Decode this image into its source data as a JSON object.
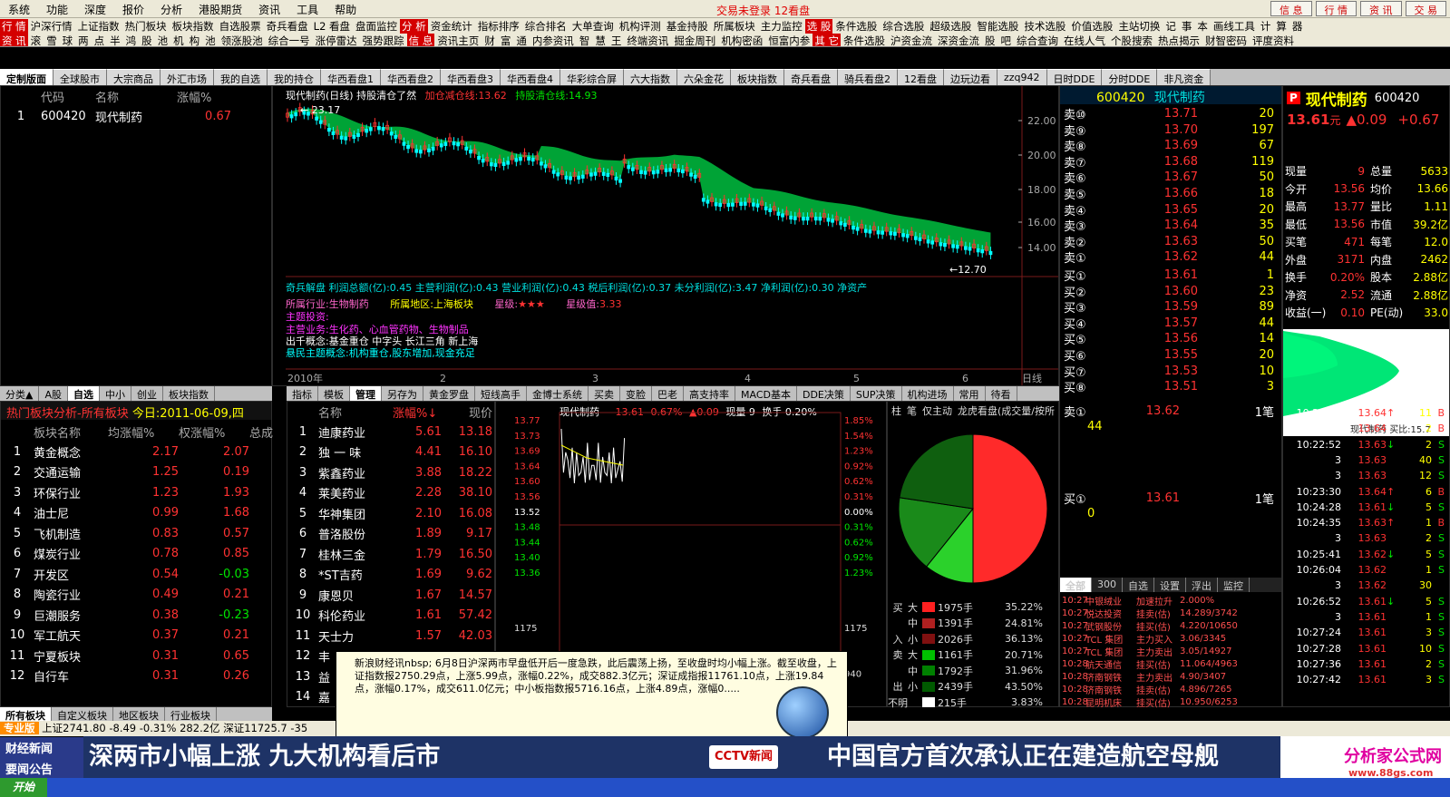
{
  "menu": {
    "items": [
      "系统",
      "功能",
      "深度",
      "报价",
      "分析",
      "港股期货",
      "资讯",
      "工具",
      "帮助"
    ],
    "center": "交易未登录 12看盘",
    "right_buttons": [
      "信 息",
      "行 情",
      "资 讯",
      "交 易"
    ]
  },
  "toolbar": {
    "row1": [
      "沪深行情",
      "上证指数",
      "热门板块",
      "板块指数",
      "自选股票",
      "奇兵看盘",
      "L2 看盘",
      "盘面监控",
      "资金统计",
      "指标排序",
      "综合排名",
      "大单查询",
      "机构评测",
      "基金持股",
      "所属板块",
      "主力监控",
      "条件选股",
      "综合选股",
      "超级选股",
      "智能选股",
      "技术选股",
      "价值选股",
      "主站切换",
      "记",
      "事",
      "本",
      "画线工具",
      "计",
      "算",
      "器"
    ],
    "row2": [
      "滚",
      "雪",
      "球",
      "两",
      "点",
      "半",
      "鸿",
      "股",
      "池",
      "机",
      "构",
      "池",
      "领涨股池",
      "综合一号",
      "涨停雷达",
      "强势跟踪",
      "资讯主页",
      "财",
      "富",
      "通",
      "内参资讯",
      "智",
      "慧",
      "王",
      "终端资讯",
      "掘金周刊",
      "机构密函",
      "恒富内参",
      "条件选股",
      "沪资金流",
      "深资金流",
      "股",
      "吧",
      "综合查询",
      "在线人气",
      "个股搜索",
      "热点揭示",
      "财智密码",
      "评度资料"
    ],
    "tags": [
      "行 情",
      "分 析",
      "资 讯",
      "选 股",
      "信 息",
      "其 它"
    ]
  },
  "tabs": [
    "定制版面",
    "全球股市",
    "大宗商品",
    "外汇市场",
    "我的自选",
    "我的持仓",
    "华西看盘1",
    "华西看盘2",
    "华西看盘3",
    "华西看盘4",
    "华彩综合屏",
    "六大指数",
    "六朵金花",
    "板块指数",
    "奇兵看盘",
    "骑兵看盘2",
    "12看盘",
    "边玩边看",
    "zzq942",
    "日时DDE",
    "分时DDE",
    "非凡资金"
  ],
  "watchlist": {
    "headers": [
      "代码",
      "名称",
      "涨幅%"
    ],
    "rows": [
      {
        "no": "1",
        "code": "600420",
        "name": "现代制药",
        "pct": "0.67"
      }
    ]
  },
  "left_subtabs": [
    "分类▲",
    "A股",
    "自选",
    "中小",
    "创业",
    "板块指数"
  ],
  "sectors": {
    "title": "热门板块分析-所有板块",
    "date": "今日:2011-06-09,四",
    "headers": [
      "板块名称",
      "均涨幅%",
      "权涨幅%",
      "总成"
    ],
    "rows": [
      [
        "1",
        "黄金概念",
        "2.17",
        "2.07"
      ],
      [
        "2",
        "交通运输",
        "1.25",
        "0.19"
      ],
      [
        "3",
        "环保行业",
        "1.23",
        "1.93"
      ],
      [
        "4",
        "油士尼",
        "0.99",
        "1.68"
      ],
      [
        "5",
        "飞机制造",
        "0.83",
        "0.57"
      ],
      [
        "6",
        "煤炭行业",
        "0.78",
        "0.85"
      ],
      [
        "7",
        "开发区",
        "0.54",
        "-0.03"
      ],
      [
        "8",
        "陶瓷行业",
        "0.49",
        "0.21"
      ],
      [
        "9",
        "巨潮服务",
        "0.38",
        "-0.23"
      ],
      [
        "10",
        "军工航天",
        "0.37",
        "0.21"
      ],
      [
        "11",
        "宁夏板块",
        "0.31",
        "0.65"
      ],
      [
        "12",
        "自行车",
        "0.31",
        "0.26"
      ]
    ],
    "bottom_tabs": [
      "所有板块",
      "自定义板块",
      "地区板块",
      "行业板块"
    ]
  },
  "kline": {
    "title": "现代制药(日线) 持股清仓了然",
    "line1_label": "加仓减仓线:",
    "line1_val": "13.62",
    "line2_label": "持股清仓线:",
    "line2_val": "14.93",
    "high_label": "23.17",
    "low_label": "12.70",
    "yticks": [
      "22.00",
      "20.00",
      "18.00",
      "16.00",
      "14.00"
    ],
    "xticks": [
      "2010年",
      "2",
      "3",
      "4",
      "5",
      "6",
      "日线"
    ],
    "fund_line": "奇兵解盘 利润总额(亿):0.45 主营利润(亿):0.43 营业利润(亿):0.43 税后利润(亿):0.37 未分利润(亿):3.47 净利润(亿):0.30 净资产",
    "industry": "所属行业:生物制药",
    "region": "所属地区:上海板块",
    "stars_label": "星级:",
    "stars": "★★★",
    "star_val_label": "星级值:",
    "star_val": "3.33",
    "topic_title": "主题投资:",
    "topic_lines": [
      "主营业务:生化药、心血管药物、生物制品",
      "出千概念:基金重仓 中字头 长江三角 新上海",
      "悬民主题概念:机构重仓,股东增加,现金充足"
    ]
  },
  "indicator_tabs": [
    "指标",
    "模板",
    "管理",
    "另存为",
    "黄金罗盘",
    "短线高手",
    "金博士系统",
    "买卖",
    "变脸",
    "巴老",
    "高支持率",
    "MACD基本",
    "DDE决策",
    "SUP决策",
    "机构进场",
    "常用",
    "待看"
  ],
  "gainers": {
    "headers": [
      "名称",
      "涨幅%↓",
      "现价"
    ],
    "rows": [
      [
        "1",
        "迪康药业",
        "5.61",
        "13.18"
      ],
      [
        "2",
        "独 一 味",
        "4.41",
        "16.10"
      ],
      [
        "3",
        "紫鑫药业",
        "3.88",
        "18.22"
      ],
      [
        "4",
        "莱美药业",
        "2.28",
        "38.10"
      ],
      [
        "5",
        "华神集团",
        "2.10",
        "16.08"
      ],
      [
        "6",
        "普洛股份",
        "1.89",
        "9.17"
      ],
      [
        "7",
        "桂林三金",
        "1.79",
        "16.50"
      ],
      [
        "8",
        "*ST吉药",
        "1.69",
        "9.62"
      ],
      [
        "9",
        "康恩贝",
        "1.67",
        "14.57"
      ],
      [
        "10",
        "科伦药业",
        "1.61",
        "57.42"
      ],
      [
        "11",
        "天士力",
        "1.57",
        "42.03"
      ],
      [
        "12",
        "丰",
        "",
        " "
      ],
      [
        "13",
        "益",
        "",
        " "
      ],
      [
        "14",
        "嘉",
        "",
        " "
      ]
    ]
  },
  "intraday": {
    "title": "现代制药",
    "price": "13.61",
    "pct": "0.67%",
    "chg": "▲0.09",
    "vol": "现量 9",
    "turnover": "换手 0.20%",
    "left_ticks": [
      "13.77",
      "13.73",
      "13.69",
      "13.64",
      "13.60",
      "13.56",
      "13.52",
      "13.48",
      "13.44",
      "13.40",
      "13.36",
      "1175",
      "940"
    ],
    "right_ticks": [
      "1.85%",
      "1.54%",
      "1.23%",
      "0.92%",
      "0.62%",
      "0.31%",
      "0.00%",
      "0.31%",
      "0.62%",
      "0.92%",
      "1.23%",
      "1175",
      "940"
    ]
  },
  "pie": {
    "tabs": [
      "柱",
      "笔",
      "仅主动",
      "龙虎看盘(成交量/按所"
    ],
    "rows": [
      {
        "side": "买",
        "size": "大",
        "vol": "1975手",
        "pct": "35.22%",
        "color": "#ff2020"
      },
      {
        "side": "",
        "size": "中",
        "vol": "1391手",
        "pct": "24.81%",
        "color": "#b02020"
      },
      {
        "side": "入",
        "size": "小",
        "vol": "2026手",
        "pct": "36.13%",
        "color": "#801010"
      },
      {
        "side": "卖",
        "size": "大",
        "vol": "1161手",
        "pct": "20.71%",
        "color": "#00c000"
      },
      {
        "side": "",
        "size": "中",
        "vol": "1792手",
        "pct": "31.96%",
        "color": "#008000"
      },
      {
        "side": "出",
        "size": "小",
        "vol": "2439手",
        "pct": "43.50%",
        "color": "#005a00"
      },
      {
        "side": "不明",
        "size": "",
        "vol": "215手",
        "pct": "3.83%",
        "color": "#ffffff"
      }
    ],
    "slices": [
      35.22,
      24.81,
      36.13,
      20.71,
      31.96,
      43.5,
      3.83
    ]
  },
  "orderbook": {
    "code": "600420",
    "name": "现代制药",
    "asks": [
      [
        "卖⑩",
        "13.71",
        "20"
      ],
      [
        "卖⑨",
        "13.70",
        "197"
      ],
      [
        "卖⑧",
        "13.69",
        "67"
      ],
      [
        "卖⑦",
        "13.68",
        "119"
      ],
      [
        "卖⑥",
        "13.67",
        "50"
      ],
      [
        "卖⑤",
        "13.66",
        "18"
      ],
      [
        "卖④",
        "13.65",
        "20"
      ],
      [
        "卖③",
        "13.64",
        "35"
      ],
      [
        "卖②",
        "13.63",
        "50"
      ],
      [
        "卖①",
        "13.62",
        "44"
      ]
    ],
    "bids": [
      [
        "买①",
        "13.61",
        "1"
      ],
      [
        "买②",
        "13.60",
        "23"
      ],
      [
        "买③",
        "13.59",
        "89"
      ],
      [
        "买④",
        "13.57",
        "44"
      ],
      [
        "买⑤",
        "13.56",
        "14"
      ],
      [
        "买⑥",
        "13.55",
        "20"
      ],
      [
        "买⑦",
        "13.53",
        "10"
      ],
      [
        "买⑧",
        "13.51",
        "3"
      ]
    ],
    "queue_sell": {
      "label": "卖①",
      "price": "13.62",
      "count": "1笔",
      "vol": "44"
    },
    "queue_buy": {
      "label": "买①",
      "price": "13.61",
      "count": "1笔",
      "vol": "0"
    },
    "subtabs": [
      "全部",
      "300",
      "自选",
      "设置",
      "浮出",
      "监控"
    ],
    "news": [
      [
        "10:27",
        "中银绒业",
        "加速拉升",
        "2.000%"
      ],
      [
        "10:27",
        "悦达投资",
        "挂卖(估)",
        "14.289/3742"
      ],
      [
        "10:27",
        "武钢股份",
        "挂买(估)",
        "4.220/10650"
      ],
      [
        "10:27",
        "TCL 集团",
        "主力买入",
        "3.06/3345"
      ],
      [
        "10:27",
        "TCL 集团",
        "主力卖出",
        "3.05/14927"
      ],
      [
        "10:28",
        "航天通信",
        "挂买(估)",
        "11.064/4963"
      ],
      [
        "10:28",
        "济南钢铁",
        "主力卖出",
        "4.90/3407"
      ],
      [
        "10:28",
        "济南钢铁",
        "挂卖(估)",
        "4.896/7265"
      ],
      [
        "10:28",
        "昆明机床",
        "挂买(估)",
        "10.950/6253"
      ]
    ]
  },
  "quote": {
    "name": "现代制药",
    "code": "600420",
    "price": "13.61",
    "unit": "元",
    "chg": "▲0.09",
    "pct": "+0.67",
    "fields": [
      [
        "现量",
        "9",
        "总量",
        "5633"
      ],
      [
        "今开",
        "13.56",
        "均价",
        "13.66"
      ],
      [
        "最高",
        "13.77",
        "量比",
        "1.11"
      ],
      [
        "最低",
        "13.56",
        "市值",
        "39.2亿"
      ],
      [
        "买笔",
        "471",
        "每笔",
        "12.0"
      ],
      [
        "外盘",
        "3171",
        "内盘",
        "2462"
      ],
      [
        "换手",
        "0.20%",
        "股本",
        "2.88亿"
      ],
      [
        "净资",
        "2.52",
        "流通",
        "2.88亿"
      ],
      [
        "收益(一)",
        "0.10",
        "PE(动)",
        "33.0"
      ]
    ],
    "chart_caption": "现代制药",
    "chart_caption2": "买比:15.7"
  },
  "ticks": [
    [
      "10:21:42",
      "13.64",
      "↑",
      "11",
      "B"
    ],
    [
      "10:22:14",
      "13.64",
      "",
      "2",
      "B"
    ],
    [
      "10:22:52",
      "13.63",
      "↓",
      "2",
      "S"
    ],
    [
      "3",
      "13.63",
      "",
      "40",
      "S"
    ],
    [
      "3",
      "13.63",
      "",
      "12",
      "S"
    ],
    [
      "10:23:30",
      "13.64",
      "↑",
      "6",
      "B"
    ],
    [
      "10:24:28",
      "13.61",
      "↓",
      "5",
      "S"
    ],
    [
      "10:24:35",
      "13.63",
      "↑",
      "1",
      "B"
    ],
    [
      "3",
      "13.63",
      "",
      "2",
      "S"
    ],
    [
      "10:25:41",
      "13.62",
      "↓",
      "5",
      "S"
    ],
    [
      "10:26:04",
      "13.62",
      "",
      "1",
      "S"
    ],
    [
      "3",
      "13.62",
      "",
      "30",
      ""
    ],
    [
      "10:26:52",
      "13.61",
      "↓",
      "5",
      "S"
    ],
    [
      "3",
      "13.61",
      "",
      "1",
      "S"
    ],
    [
      "10:27:24",
      "13.61",
      "",
      "3",
      "S"
    ],
    [
      "10:27:28",
      "13.61",
      "",
      "10",
      "S"
    ],
    [
      "10:27:36",
      "13.61",
      "",
      "2",
      "S"
    ],
    [
      "10:27:42",
      "13.61",
      "",
      "3",
      "S"
    ]
  ],
  "statusbar": {
    "badge": "专业版",
    "text": "上证2741.80 -8.49 -0.31% 282.2亿 深证11725.7 -35"
  },
  "popup": {
    "text": "新浪财经讯nbsp; 6月8日沪深两市早盘低开后一度急跌，此后震荡上扬，至收盘时均小幅上涨。截至收盘，上证指数报2750.29点，上涨5.99点，涨幅0.22%，成交882.3亿元；深证成指报11761.10点，上涨19.84点，涨幅0.17%，成交611.0亿元；中小板指数报5716.16点，上涨4.89点，涨幅0....."
  },
  "ticker": {
    "left1": "财经新闻",
    "left2": "要闻公告",
    "text": "深两市小幅上涨  九大机构看后市",
    "logo": "CCTV新闻",
    "text2": "中国官方首次承认正在建造航空母舰",
    "brand": "分析家公式网",
    "brand_url": "www.88gs.com",
    "footer": "开始"
  }
}
